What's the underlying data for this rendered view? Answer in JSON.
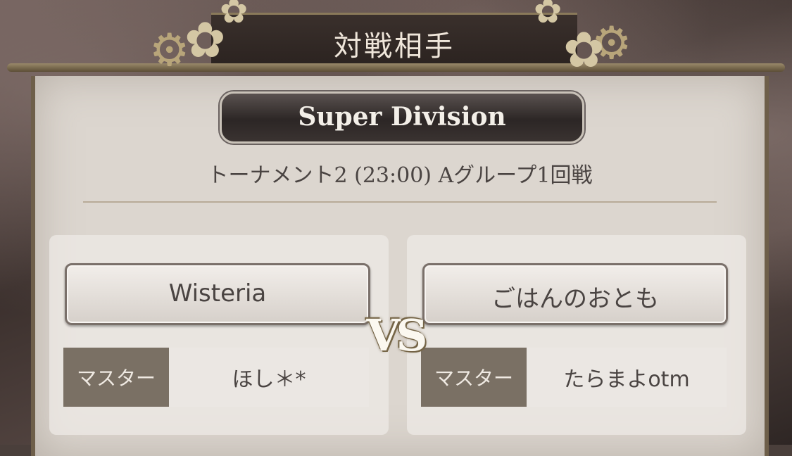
{
  "header": {
    "title": "対戦相手"
  },
  "division": {
    "label": "Super Division"
  },
  "match": {
    "subtitle": "トーナメント2 (23:00)  Aグループ1回戦"
  },
  "vs_label": "VS",
  "left_team": {
    "name": "Wisteria",
    "master_label": "マスター",
    "master_name": "ほし＊*"
  },
  "right_team": {
    "name": "ごはんのおとも",
    "master_label": "マスター",
    "master_name": "たらまよotm"
  },
  "colors": {
    "panel": "#dcd6cf",
    "accent": "#7a7064",
    "plate": "#2c2625"
  }
}
